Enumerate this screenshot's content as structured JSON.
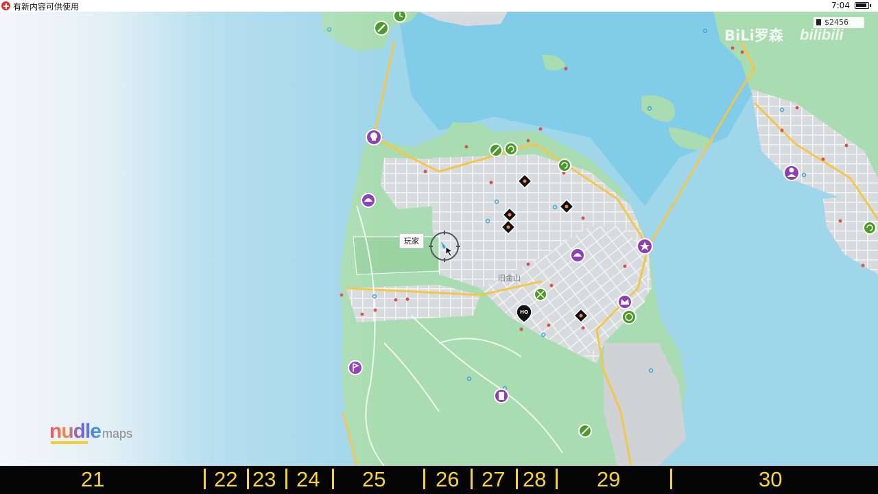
{
  "status_bar": {
    "notification": "有新内容可供使用",
    "time": "7:04"
  },
  "hud": {
    "money": "$2456",
    "player_label": "玩家",
    "district_label": "旧金山"
  },
  "overlays": {
    "watermark": "BiLi罗森",
    "watermark_logo": "bilibili",
    "brand_name": "nudle",
    "brand_suffix": "maps"
  },
  "timeline": {
    "ticks": [
      "21",
      "22",
      "23",
      "24",
      "25",
      "26",
      "27",
      "28",
      "29",
      "30"
    ]
  },
  "icons": [
    {
      "name": "skull-icon",
      "color": "#8e3fb1"
    },
    {
      "name": "wrench-icon",
      "color": "#4c9a2a"
    },
    {
      "name": "clock-icon",
      "color": "#4c9a2a"
    },
    {
      "name": "car-icon",
      "color": "#8e3fb1"
    },
    {
      "name": "hq-icon",
      "color": "#111111"
    },
    {
      "name": "diamond-icon",
      "color": "#111111"
    },
    {
      "name": "phone-icon",
      "color": "#8e3fb1"
    }
  ],
  "colors": {
    "water": "#9fd6ea",
    "land": "#a9dcb0",
    "city": "#d9dcdf",
    "road": "#f3c64a",
    "timeline_text": "#f6d33b"
  }
}
